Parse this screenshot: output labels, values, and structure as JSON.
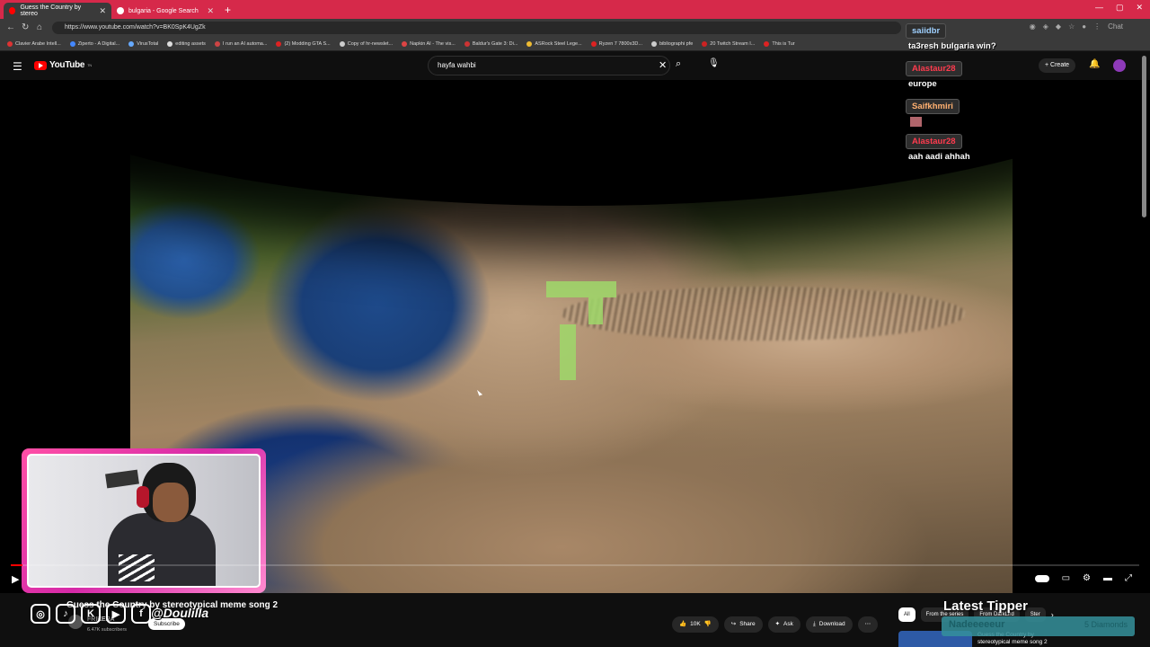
{
  "browser": {
    "tabs": [
      {
        "title": "Guess the Country by stereo",
        "active": true
      },
      {
        "title": "bulgaria - Google Search",
        "active": false
      }
    ],
    "url": "https://www.youtube.com/watch?v=BK0SpK4UgZk",
    "bookmarks": [
      "Clavier Arabe Intell...",
      "Ziperto - A Digital...",
      "VirusTotal",
      "editing assets",
      "I run an AI automa...",
      "(2) Modding GTA S...",
      "Copy of hr-newslet...",
      "Napkin AI - The vis...",
      "Baldur's Gate 3: Di...",
      "ASRock Steel Lege...",
      "Ryzen 7 7800x3D...",
      "bibliographi pfe",
      "20 Twitch Stream I...",
      "This is Tur"
    ],
    "chat_ext_label": "Chat"
  },
  "youtube": {
    "logo_text": "YouTube",
    "logo_sup": "TN",
    "search_value": "hayfa wahbi",
    "create_label": "Create",
    "video_title": "Guess the Country by stereotypical meme song 2",
    "channel_name": "FRIKERA",
    "subscribers": "6.47K subscribers",
    "subscribe_label": "Subscribe",
    "likes": "10K",
    "share_label": "Share",
    "ask_label": "Ask",
    "download_label": "Download",
    "chips": [
      "All",
      "From the series",
      "From DarkLird",
      "Ster"
    ],
    "rec_title": "Guess the Country by stereotypical meme song 2",
    "progress_fraction": 0.01
  },
  "overlay": {
    "social_handle": "@Doulilla",
    "latest_tipper_label": "Latest Tipper",
    "tipper_name": "Nadeeeeeur",
    "tipper_amount": "5 Diamonds"
  },
  "chat": [
    {
      "user": "saiidbr",
      "color": "#9fd0ff",
      "message": "ta3resh bulgaria win?"
    },
    {
      "user": "Alastaur28",
      "color": "#ff3b4e",
      "message": "europe"
    },
    {
      "user": "Saifkhmiri",
      "color": "#ffb070",
      "message": ""
    },
    {
      "user": "Alastaur28",
      "color": "#ff3b4e",
      "message": "aah aadi ahhah"
    }
  ]
}
